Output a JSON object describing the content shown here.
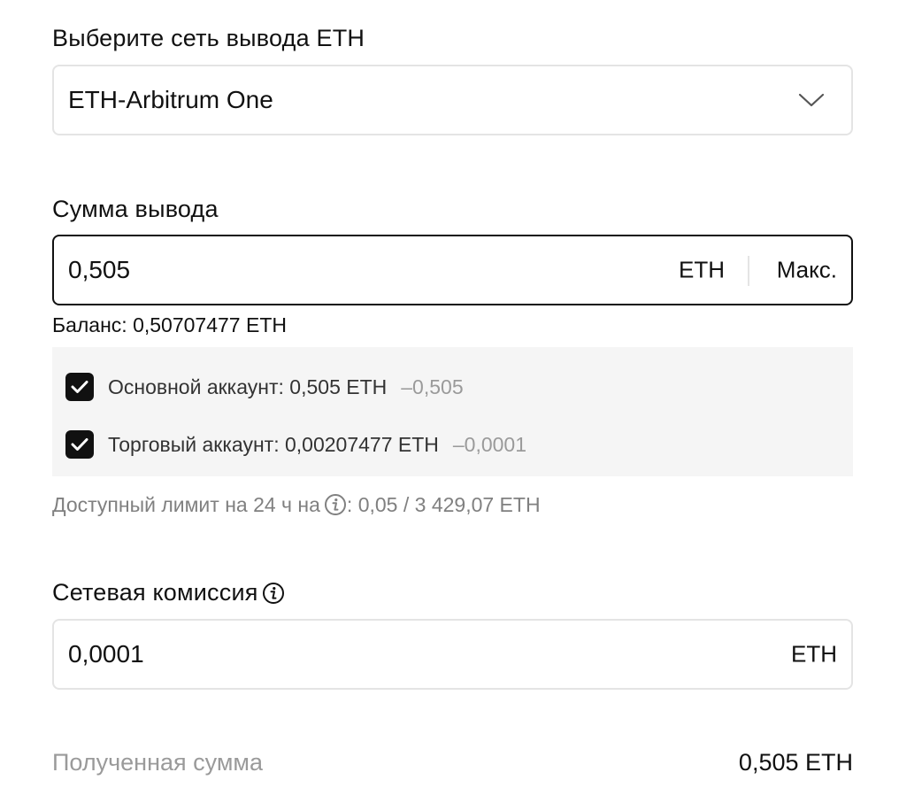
{
  "network": {
    "title": "Выберите сеть вывода ETH",
    "selected": "ETH-Arbitrum One",
    "chevron_icon": "chevron-down-icon"
  },
  "amount": {
    "title": "Сумма вывода",
    "value": "0,505",
    "unit": "ETH",
    "max_label": "Макс.",
    "balance": "Баланс: 0,50707477 ETH"
  },
  "accounts": [
    {
      "label": "Основной аккаунт: 0,505 ETH",
      "delta": "–0,505",
      "checked": true
    },
    {
      "label": "Торговый аккаунт: 0,00207477 ETH",
      "delta": "–0,0001",
      "checked": true
    }
  ],
  "limit": {
    "prefix": "Доступный лимит на 24 ч на",
    "suffix": ": 0,05 / 3 429,07 ETH",
    "info_icon": "info-icon"
  },
  "fee": {
    "title": "Сетевая комиссия",
    "value": "0,0001",
    "unit": "ETH",
    "info_icon": "info-icon"
  },
  "received": {
    "label": "Полученная сумма",
    "value": "0,505 ETH"
  },
  "colors": {
    "checkbox": "#111111",
    "border": "#e4e4e4",
    "muted_text": "#808080",
    "box_bg": "#f5f5f5"
  }
}
